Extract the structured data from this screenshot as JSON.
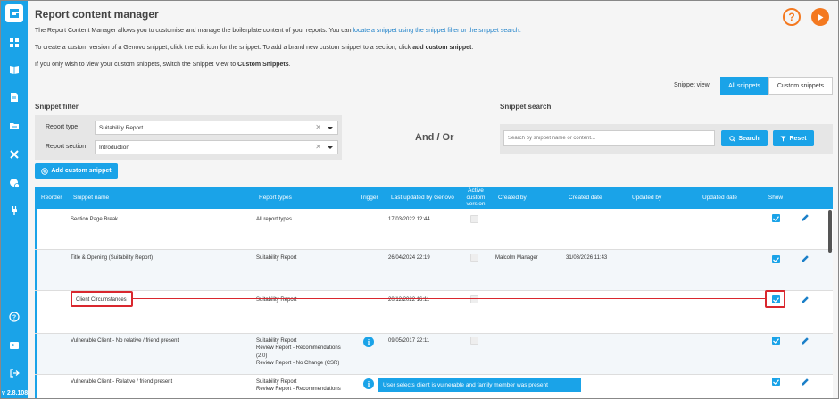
{
  "app": {
    "version": "v 2.8.108"
  },
  "page": {
    "title": "Report content manager",
    "intro1_prefix": "The Report Content Manager allows you to customise and manage the boilerplate content of your reports. You can ",
    "intro1_link": "locate a snippet using the snippet filter or the snippet search.",
    "intro2_prefix": "To create a custom version of a Genovo snippet, click the edit icon for the snippet. To add a brand new custom snippet to a section, click ",
    "intro2_bold": "add custom snippet",
    "intro2_suffix": ".",
    "intro3_prefix": "If you only wish to view your custom snippets, switch the Snippet View to ",
    "intro3_bold": "Custom Snippets",
    "intro3_suffix": "."
  },
  "snippet_view": {
    "label": "Snippet view",
    "all_label": "All snippets",
    "custom_label": "Custom snippets"
  },
  "filter": {
    "title": "Snippet filter",
    "report_type_label": "Report type",
    "report_type_value": "Suitability Report",
    "report_section_label": "Report section",
    "report_section_value": "Introduction"
  },
  "and_or": "And / Or",
  "search": {
    "title": "Snippet search",
    "placeholder": "Search by snippet name or content...",
    "search_label": "Search",
    "reset_label": "Reset"
  },
  "add_button_label": "Add custom snippet",
  "table": {
    "headers": {
      "reorder": "Reorder",
      "snippet_name": "Snippet name",
      "report_types": "Report types",
      "trigger": "Trigger",
      "last_updated": "Last updated by Genovo",
      "active_custom": "Active custom version",
      "created_by": "Created by",
      "created_date": "Created date",
      "updated_by": "Updated by",
      "updated_date": "Updated date",
      "show": "Show"
    },
    "rows": [
      {
        "name": "Section Page Break",
        "report_types": [
          "All report types"
        ],
        "last_updated": "17/03/2022 12:44",
        "created_by": "",
        "created_date": "",
        "show": true,
        "trigger": false
      },
      {
        "name": "Title & Opening (Suitability Report)",
        "report_types": [
          "Suitability Report"
        ],
        "last_updated": "26/04/2024 22:19",
        "created_by": "Malcolm Manager",
        "created_date": "31/03/2026 11:43",
        "show": true,
        "trigger": false
      },
      {
        "name": "Client Circumstances",
        "report_types": [
          "Suitability Report"
        ],
        "last_updated": "20/12/2022 16:11",
        "created_by": "",
        "created_date": "",
        "show": true,
        "trigger": false
      },
      {
        "name": "Vulnerable Client - No relative / friend present",
        "report_types": [
          "Suitability Report",
          "Review Report - Recommendations",
          "(2.0)",
          "Review Report - No Change (CSR)"
        ],
        "last_updated": "09/05/2017 22:11",
        "created_by": "",
        "created_date": "",
        "show": true,
        "trigger": true
      },
      {
        "name": "Vulnerable Client - Relative / friend present",
        "report_types": [
          "Suitability Report",
          "Review Report - Recommendations"
        ],
        "last_updated": "",
        "created_by": "",
        "created_date": "",
        "show": true,
        "trigger": true
      }
    ]
  },
  "tooltip": "User selects client is vulnerable and family member was present",
  "colors": {
    "accent": "#1aa3e8",
    "orange": "#f47920",
    "highlight": "#d9272e"
  }
}
